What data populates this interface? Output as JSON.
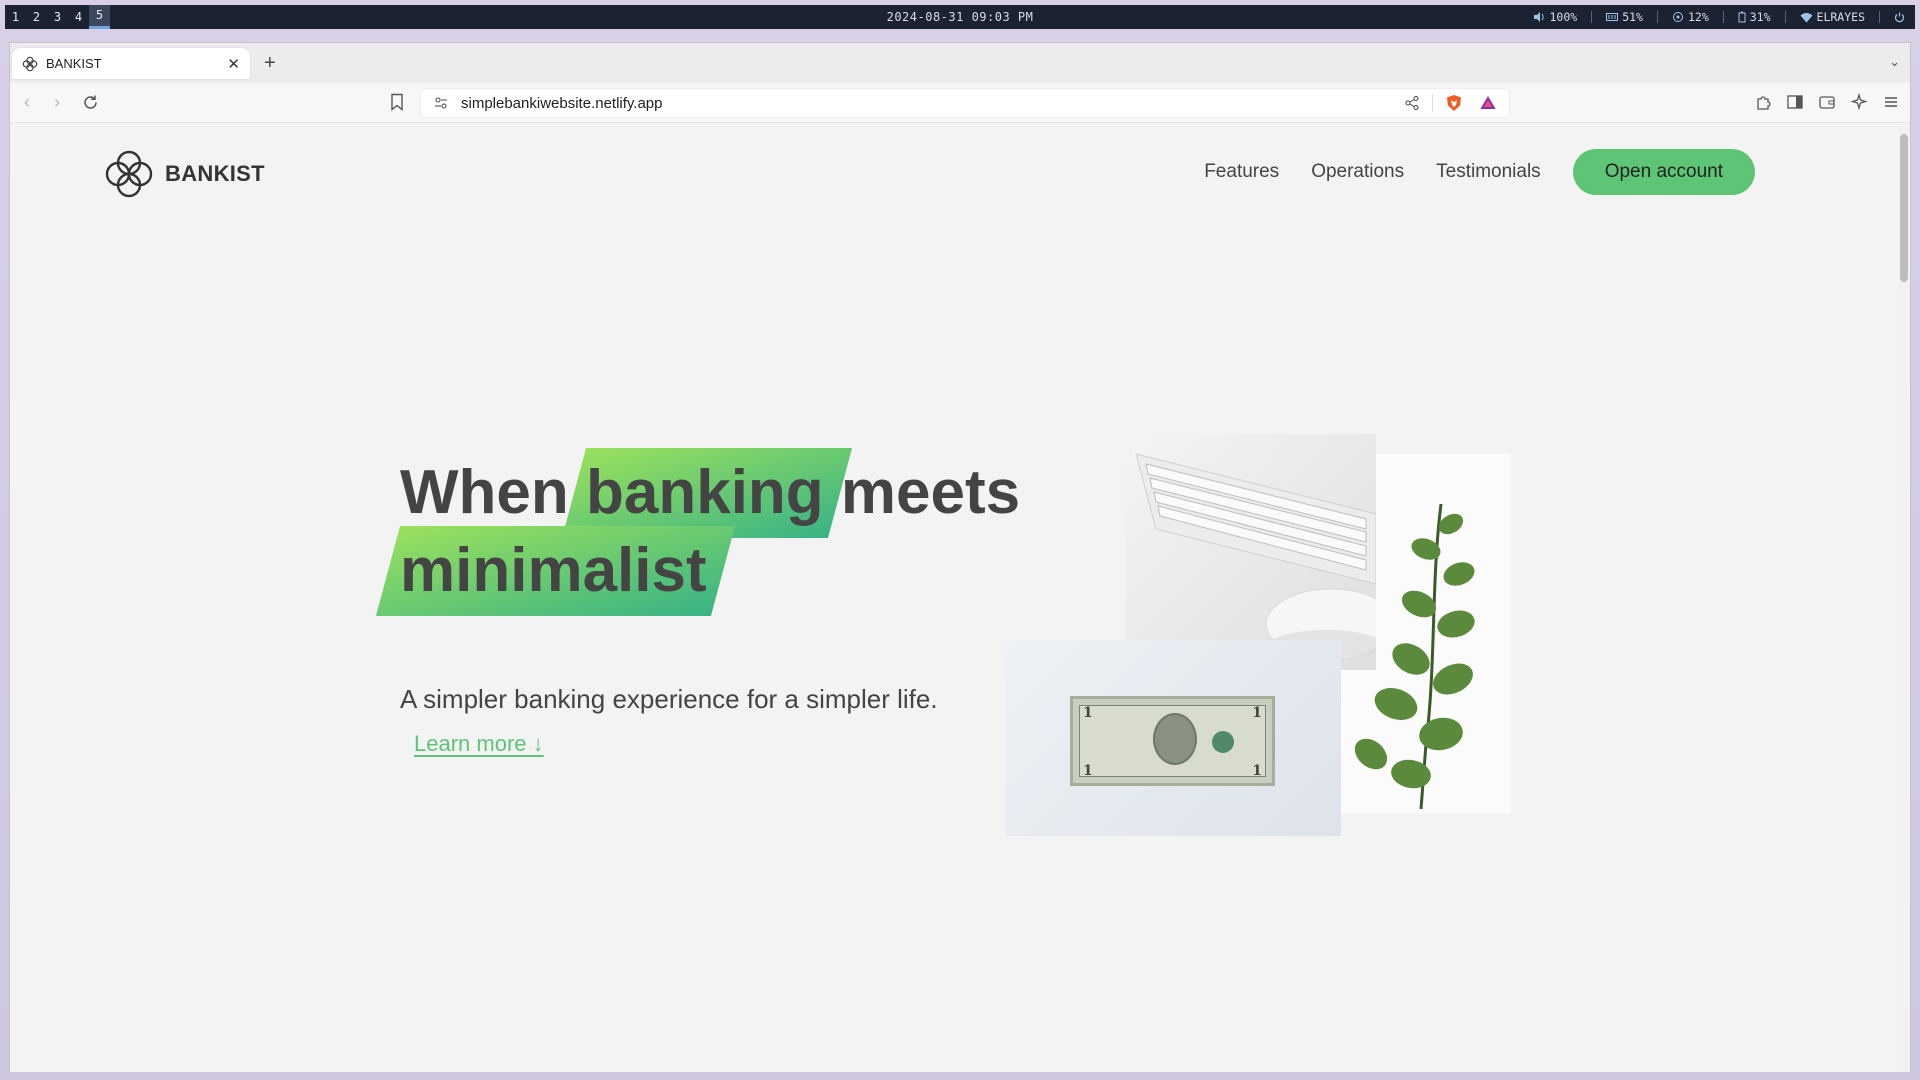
{
  "system_bar": {
    "workspaces": [
      "1",
      "2",
      "3",
      "4",
      "5"
    ],
    "active_workspace": "5",
    "clock": "2024-08-31 09:03 PM",
    "volume": "100%",
    "memory": "51%",
    "cpu": "12%",
    "battery": "31%",
    "network": "ELRAYES"
  },
  "browser": {
    "tab_title": "BANKIST",
    "url": "simplebankiwebsite.netlify.app"
  },
  "site": {
    "logo_text": "BANKIST",
    "nav": {
      "features": "Features",
      "operations": "Operations",
      "testimonials": "Testimonials",
      "open_account": "Open account"
    },
    "hero": {
      "word_when": "When",
      "word_banking": "banking",
      "word_meets": "meets",
      "word_minimalist": "minimalist",
      "subtitle": "A simpler banking experience for a simpler life.",
      "learn_more": "Learn more ↓"
    }
  },
  "colors": {
    "primary": "#5ec576",
    "gradient_start": "#9be15d",
    "gradient_end": "#39b385",
    "heading": "#444444"
  }
}
